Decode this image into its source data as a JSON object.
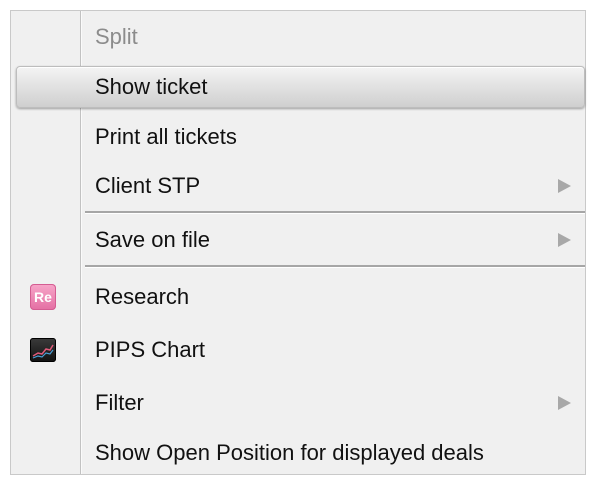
{
  "menu": {
    "items": [
      {
        "label": "Split"
      },
      {
        "label": "Show ticket"
      },
      {
        "label": "Print all tickets"
      },
      {
        "label": "Client STP"
      },
      {
        "label": "Save on file"
      },
      {
        "label": "Research",
        "icon_text": "Re"
      },
      {
        "label": "PIPS Chart"
      },
      {
        "label": "Filter"
      },
      {
        "label": "Show Open Position for displayed deals"
      }
    ]
  },
  "colors": {
    "menu_background": "#f0f0f0",
    "disabled_text": "#8c8c8c",
    "research_icon": "#e46fa3",
    "chart_icon": "#1a1a1a"
  },
  "icons": {
    "research": "research-icon",
    "pips_chart": "pips-chart-icon",
    "submenu": "submenu-arrow-icon"
  }
}
